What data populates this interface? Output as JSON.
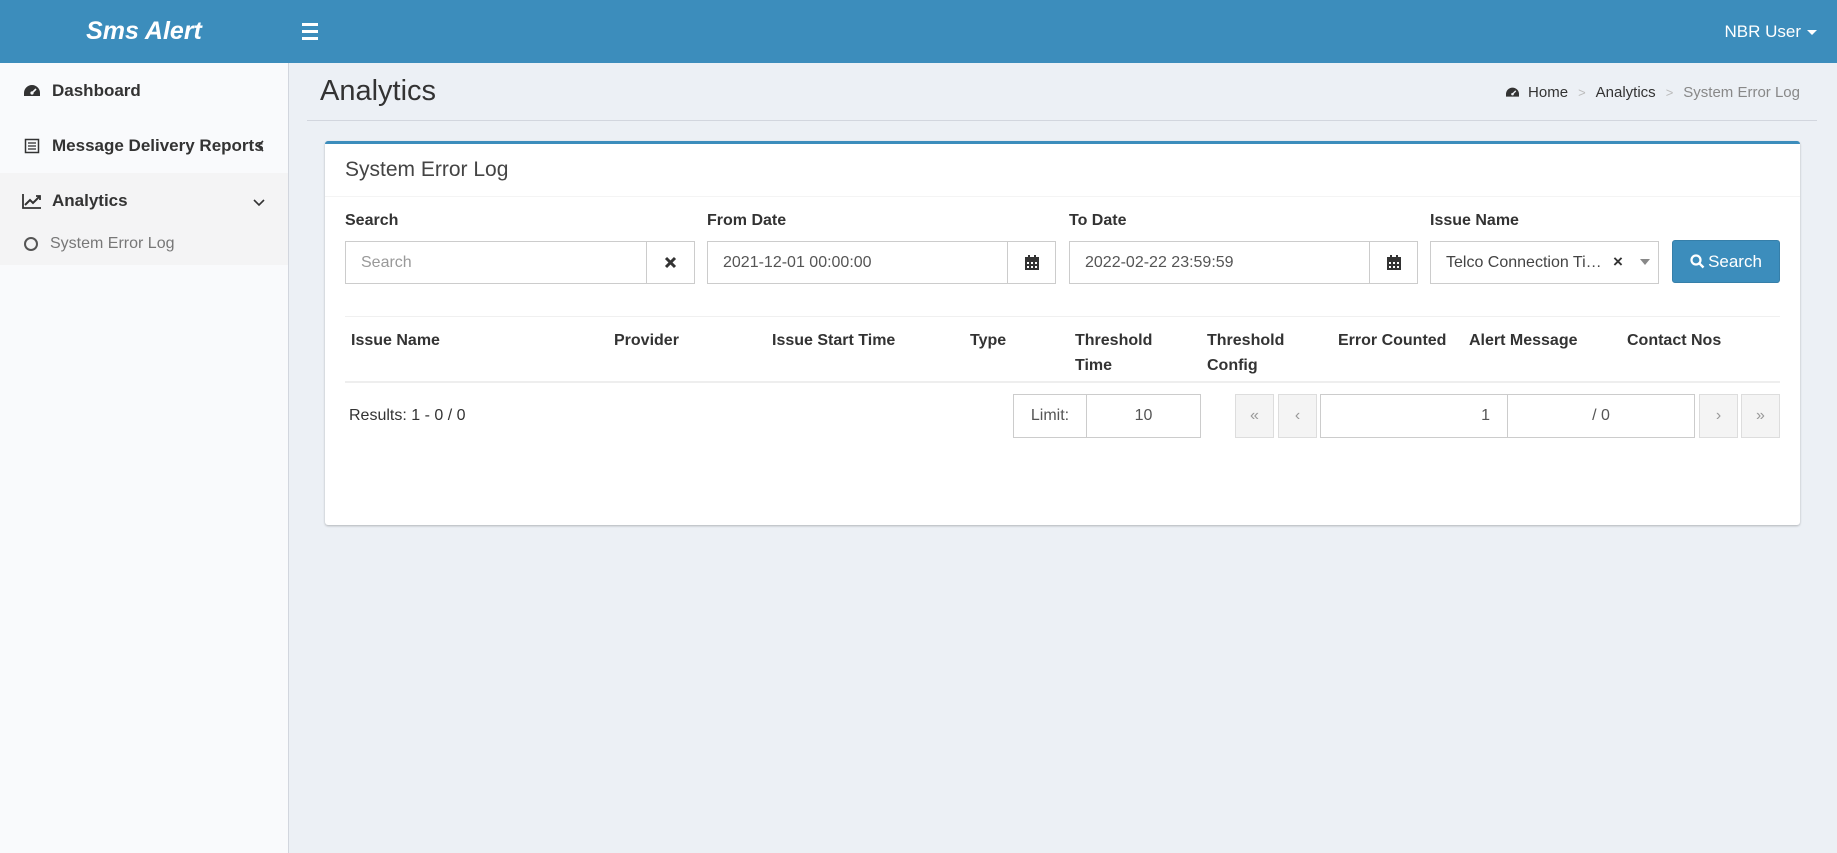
{
  "app": {
    "logo": "Sms Alert",
    "user": "NBR User"
  },
  "sidebar": {
    "items": [
      {
        "label": "Dashboard"
      },
      {
        "label": "Message Delivery Reports"
      },
      {
        "label": "Analytics"
      }
    ],
    "sub_items": [
      {
        "label": "System Error Log"
      }
    ]
  },
  "header": {
    "title": "Analytics",
    "breadcrumb": [
      "Home",
      "Analytics",
      "System Error Log"
    ]
  },
  "box": {
    "title": "System Error Log",
    "filters": {
      "search_label": "Search",
      "search_placeholder": "Search",
      "from_label": "From Date",
      "from_value": "2021-12-01 00:00:00",
      "to_label": "To Date",
      "to_value": "2022-02-22 23:59:59",
      "issue_label": "Issue Name",
      "issue_value": "Telco Connection Timeout",
      "search_button": "Search"
    },
    "table": {
      "columns": [
        {
          "line1": "",
          "line2": "Issue Name"
        },
        {
          "line1": "",
          "line2": "Provider"
        },
        {
          "line1": "",
          "line2": "Issue Start Time"
        },
        {
          "line1": "",
          "line2": "Type"
        },
        {
          "line1": "Threshold",
          "line2": "Time"
        },
        {
          "line1": "Threshold",
          "line2": "Config"
        },
        {
          "line1": "",
          "line2": "Error Counted"
        },
        {
          "line1": "",
          "line2": "Alert Message"
        },
        {
          "line1": "",
          "line2": "Contact Nos"
        }
      ],
      "rows": []
    },
    "footer": {
      "results": "Results: 1 - 0 / 0",
      "limit_label": "Limit:",
      "limit_value": "10",
      "page_value": "1",
      "page_total": "/ 0",
      "first": "«",
      "prev": "‹",
      "next": "›",
      "last": "»"
    }
  },
  "colors": {
    "primary": "#3c8dbc",
    "background": "#ecf0f5"
  }
}
